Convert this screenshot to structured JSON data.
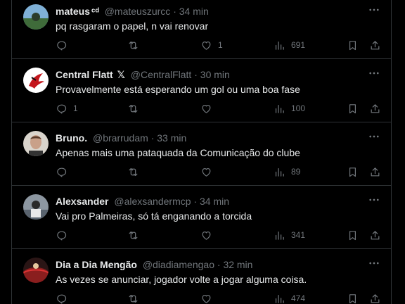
{
  "tweets": [
    {
      "name": "mateus",
      "badge": "ᶜᵈ",
      "handle": "@mateuszurcc",
      "dot": "·",
      "time": "34 min",
      "text": "pq rasgaram o papel, n vai renovar",
      "replies": "",
      "retweets": "",
      "likes": "1",
      "views": "691",
      "avatar_color": "#3f6b3a"
    },
    {
      "name": "Central Flatt",
      "badge": "𝕏",
      "handle": "@CentralFlatt",
      "dot": "·",
      "time": "30 min",
      "text": "Provavelmente está esperando um gol ou uma boa fase",
      "replies": "1",
      "retweets": "",
      "likes": "",
      "views": "100",
      "avatar_color": "#c4161c"
    },
    {
      "name": "Bruno.",
      "badge": "",
      "handle": "@brarrudam",
      "dot": "·",
      "time": "33 min",
      "text": "Apenas mais uma pataquada da Comunicação do clube",
      "replies": "",
      "retweets": "",
      "likes": "",
      "views": "89",
      "avatar_color": "#c9a089"
    },
    {
      "name": "Alexsander",
      "badge": "",
      "handle": "@alexsandermcp",
      "dot": "·",
      "time": "34 min",
      "text": "Vai pro Palmeiras, só tá enganando a torcida",
      "replies": "",
      "retweets": "",
      "likes": "",
      "views": "341",
      "avatar_color": "#59636e"
    },
    {
      "name": "Dia a Dia Mengão",
      "badge": "",
      "handle": "@diadiamengao",
      "dot": "·",
      "time": "32 min",
      "text": "As vezes se anunciar, jogador volte a jogar alguma coisa.",
      "replies": "",
      "retweets": "",
      "likes": "",
      "views": "474",
      "avatar_color": "#8a1e1e"
    }
  ],
  "icons": {
    "reply": "reply-icon",
    "retweet": "retweet-icon",
    "like": "heart-icon",
    "views": "views-icon",
    "bookmark": "bookmark-icon",
    "share": "share-icon",
    "more": "more-icon"
  }
}
